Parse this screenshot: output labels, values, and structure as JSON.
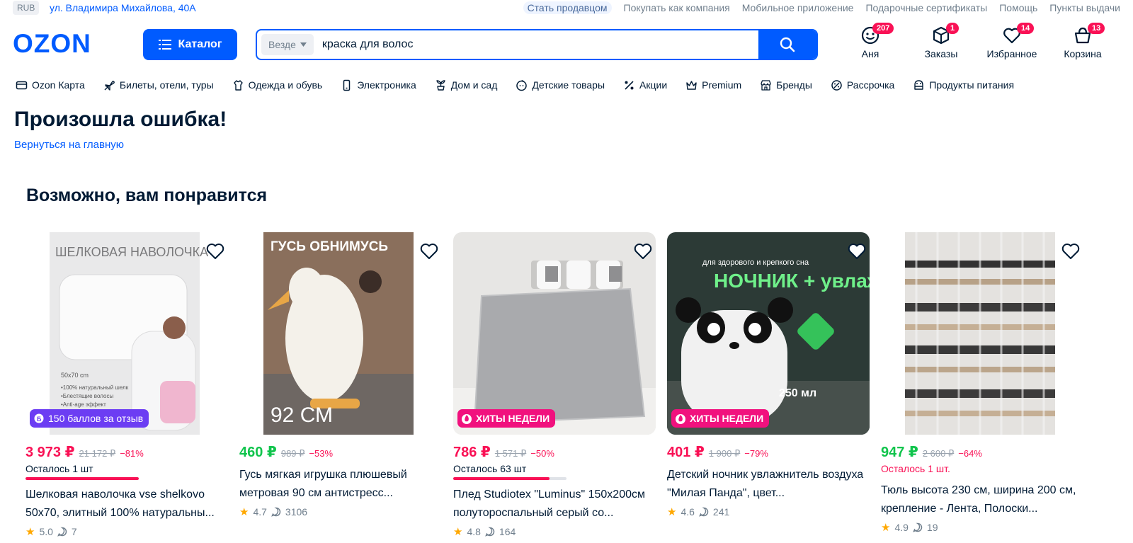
{
  "topbar": {
    "currency": "RUB",
    "address": "ул. Владимира Михайлова, 40А",
    "links": [
      "Стать продавцом",
      "Покупать как компания",
      "Мобильное приложение",
      "Подарочные сертификаты",
      "Помощь",
      "Пункты выдачи"
    ]
  },
  "header": {
    "logo": "OZON",
    "catalog_label": "Каталог",
    "search_scope": "Везде",
    "search_value": "краска для волос",
    "icons": [
      {
        "label": "Аня",
        "badge": "207",
        "icon": "profile-icon"
      },
      {
        "label": "Заказы",
        "badge": "1",
        "icon": "box-icon"
      },
      {
        "label": "Избранное",
        "badge": "14",
        "icon": "heart-icon"
      },
      {
        "label": "Корзина",
        "badge": "13",
        "icon": "cart-icon"
      }
    ]
  },
  "nav": [
    {
      "label": "Ozon Карта",
      "icon": "card-icon"
    },
    {
      "label": "Билеты, отели, туры",
      "icon": "plane-icon"
    },
    {
      "label": "Одежда и обувь",
      "icon": "clothes-icon"
    },
    {
      "label": "Электроника",
      "icon": "phone-icon"
    },
    {
      "label": "Дом и сад",
      "icon": "plant-icon"
    },
    {
      "label": "Детские товары",
      "icon": "baby-icon"
    },
    {
      "label": "Акции",
      "icon": "percent-icon"
    },
    {
      "label": "Premium",
      "icon": "crown-icon"
    },
    {
      "label": "Бренды",
      "icon": "store-icon"
    },
    {
      "label": "Рассрочка",
      "icon": "installment-icon"
    },
    {
      "label": "Продукты питания",
      "icon": "food-icon"
    }
  ],
  "error": {
    "title": "Произошла ошибка!",
    "link": "Вернуться на главную"
  },
  "recommendations": {
    "title": "Возможно, вам понравится",
    "products": [
      {
        "image_text": "ШЕЛКОВАЯ НАВОЛОЧКА",
        "promo": "150 баллов за отзыв",
        "price": "3 973 ₽",
        "old_price": "21 172 ₽",
        "discount": "−81%",
        "stock": "Осталось 1 шт",
        "stock_fraction": 1.0,
        "name": "Шелковая наволочка vse shelkovo 50x70, элитный 100% натуральны...",
        "rating": "5.0",
        "reviews": "7"
      },
      {
        "image_text": "ГУСЬ ОБНИМУСЬ",
        "promo": "",
        "price": "460 ₽",
        "old_price": "989 ₽",
        "discount": "−53%",
        "stock": "",
        "name": "Гусь мягкая игрушка плюшевый метровая 90 см антистресс...",
        "rating": "4.7",
        "reviews": "3106"
      },
      {
        "image_text": "",
        "promo": "ХИТЫ НЕДЕЛИ",
        "price": "786 ₽",
        "old_price": "1 571 ₽",
        "discount": "−50%",
        "stock": "Осталось 63 шт",
        "stock_fraction": 0.85,
        "name": "Плед Studiotex \"Luminus\" 150x200см полутороспальный серый со...",
        "rating": "4.8",
        "reviews": "164"
      },
      {
        "image_text": "НОЧНИК + увлажнитель",
        "promo": "ХИТЫ НЕДЕЛИ",
        "price": "401 ₽",
        "old_price": "1 900 ₽",
        "discount": "−79%",
        "stock": "",
        "name": "Детский ночник увлажнитель воздуха \"Милая Панда\", цвет...",
        "rating": "4.6",
        "reviews": "241"
      },
      {
        "image_text": "",
        "promo": "",
        "price": "947 ₽",
        "old_price": "2 600 ₽",
        "discount": "−64%",
        "stock": "Осталось 1 шт.",
        "name": "Тюль высота 230 см, ширина 200 см, крепление - Лента, Полоски...",
        "rating": "4.9",
        "reviews": "19"
      }
    ]
  },
  "colors": {
    "brand": "#005bff",
    "price_red": "#f91155",
    "price_green": "#10c44c",
    "promo_purple": "#6c3df3",
    "promo_pink": "#f1117e",
    "star": "#ffa800"
  }
}
